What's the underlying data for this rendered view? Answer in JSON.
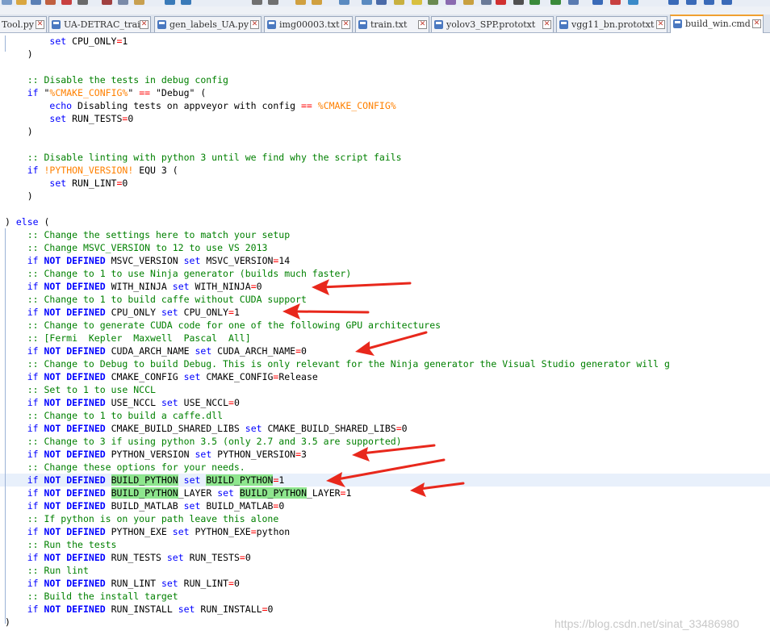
{
  "tabs": [
    {
      "label": "Tool.py"
    },
    {
      "label": "UA-DETRAC_train"
    },
    {
      "label": "gen_labels_UA.py"
    },
    {
      "label": "img00003.txt"
    },
    {
      "label": "train.txt"
    },
    {
      "label": "yolov3_SPP.prototxt"
    },
    {
      "label": "vgg11_bn.prototxt"
    },
    {
      "label": "build_win.cmd"
    }
  ],
  "active_tab_index": 7,
  "colors": {
    "keyword": "#0000ff",
    "comment": "#008000",
    "operator": "#ff0000",
    "variable": "#ff8000",
    "match_highlight": "#8ee68e",
    "arrow": "#e8281c"
  },
  "code_lines": [
    [
      {
        "t": "        "
      },
      {
        "t": "set",
        "s": "k"
      },
      {
        "t": " CPU_ONLY"
      },
      {
        "t": "=",
        "s": "o"
      },
      {
        "t": "1"
      }
    ],
    [
      {
        "t": "    )"
      }
    ],
    [
      {
        "t": ""
      }
    ],
    [
      {
        "t": "    "
      },
      {
        "t": ":: Disable the tests in debug config",
        "s": "c"
      }
    ],
    [
      {
        "t": "    "
      },
      {
        "t": "if",
        "s": "k"
      },
      {
        "t": " \""
      },
      {
        "t": "%CMAKE_CONFIG%",
        "s": "v"
      },
      {
        "t": "\" "
      },
      {
        "t": "==",
        "s": "o"
      },
      {
        "t": " \"Debug\" ("
      }
    ],
    [
      {
        "t": "        "
      },
      {
        "t": "echo",
        "s": "k"
      },
      {
        "t": " Disabling tests on appveyor with config "
      },
      {
        "t": "==",
        "s": "o"
      },
      {
        "t": " "
      },
      {
        "t": "%CMAKE_CONFIG%",
        "s": "v"
      }
    ],
    [
      {
        "t": "        "
      },
      {
        "t": "set",
        "s": "k"
      },
      {
        "t": " RUN_TESTS"
      },
      {
        "t": "=",
        "s": "o"
      },
      {
        "t": "0"
      }
    ],
    [
      {
        "t": "    )"
      }
    ],
    [
      {
        "t": ""
      }
    ],
    [
      {
        "t": "    "
      },
      {
        "t": ":: Disable linting with python 3 until we find why the script fails",
        "s": "c"
      }
    ],
    [
      {
        "t": "    "
      },
      {
        "t": "if",
        "s": "k"
      },
      {
        "t": " "
      },
      {
        "t": "!PYTHON_VERSION!",
        "s": "v"
      },
      {
        "t": " EQU 3 ("
      }
    ],
    [
      {
        "t": "        "
      },
      {
        "t": "set",
        "s": "k"
      },
      {
        "t": " RUN_LINT"
      },
      {
        "t": "=",
        "s": "o"
      },
      {
        "t": "0"
      }
    ],
    [
      {
        "t": "    )"
      }
    ],
    [
      {
        "t": ""
      }
    ],
    [
      {
        "t": ") "
      },
      {
        "t": "else",
        "s": "k"
      },
      {
        "t": " ("
      }
    ],
    [
      {
        "t": "    "
      },
      {
        "t": ":: Change the settings here to match your setup",
        "s": "c"
      }
    ],
    [
      {
        "t": "    "
      },
      {
        "t": ":: Change MSVC_VERSION to 12 to use VS 2013",
        "s": "c"
      }
    ],
    [
      {
        "t": "    "
      },
      {
        "t": "if",
        "s": "k"
      },
      {
        "t": " "
      },
      {
        "t": "NOT",
        "s": "kb"
      },
      {
        "t": " "
      },
      {
        "t": "DEFINED",
        "s": "kb"
      },
      {
        "t": " MSVC_VERSION "
      },
      {
        "t": "set",
        "s": "k"
      },
      {
        "t": " MSVC_VERSION"
      },
      {
        "t": "=",
        "s": "o"
      },
      {
        "t": "14"
      }
    ],
    [
      {
        "t": "    "
      },
      {
        "t": ":: Change to 1 to use Ninja generator (builds much faster)",
        "s": "c"
      }
    ],
    [
      {
        "t": "    "
      },
      {
        "t": "if",
        "s": "k"
      },
      {
        "t": " "
      },
      {
        "t": "NOT",
        "s": "kb"
      },
      {
        "t": " "
      },
      {
        "t": "DEFINED",
        "s": "kb"
      },
      {
        "t": " WITH_NINJA "
      },
      {
        "t": "set",
        "s": "k"
      },
      {
        "t": " WITH_NINJA"
      },
      {
        "t": "=",
        "s": "o"
      },
      {
        "t": "0"
      }
    ],
    [
      {
        "t": "    "
      },
      {
        "t": ":: Change to 1 to build caffe without CUDA support",
        "s": "c"
      }
    ],
    [
      {
        "t": "    "
      },
      {
        "t": "if",
        "s": "k"
      },
      {
        "t": " "
      },
      {
        "t": "NOT",
        "s": "kb"
      },
      {
        "t": " "
      },
      {
        "t": "DEFINED",
        "s": "kb"
      },
      {
        "t": " CPU_ONLY "
      },
      {
        "t": "set",
        "s": "k"
      },
      {
        "t": " CPU_ONLY"
      },
      {
        "t": "=",
        "s": "o"
      },
      {
        "t": "1"
      }
    ],
    [
      {
        "t": "    "
      },
      {
        "t": ":: Change to generate CUDA code for one of the following GPU architectures",
        "s": "c"
      }
    ],
    [
      {
        "t": "    "
      },
      {
        "t": ":: [Fermi  Kepler  Maxwell  Pascal  All]",
        "s": "c"
      }
    ],
    [
      {
        "t": "    "
      },
      {
        "t": "if",
        "s": "k"
      },
      {
        "t": " "
      },
      {
        "t": "NOT",
        "s": "kb"
      },
      {
        "t": " "
      },
      {
        "t": "DEFINED",
        "s": "kb"
      },
      {
        "t": " CUDA_ARCH_NAME "
      },
      {
        "t": "set",
        "s": "k"
      },
      {
        "t": " CUDA_ARCH_NAME"
      },
      {
        "t": "=",
        "s": "o"
      },
      {
        "t": "0"
      }
    ],
    [
      {
        "t": "    "
      },
      {
        "t": ":: Change to Debug to build Debug. This is only relevant for the Ninja generator the Visual Studio generator will g",
        "s": "c"
      }
    ],
    [
      {
        "t": "    "
      },
      {
        "t": "if",
        "s": "k"
      },
      {
        "t": " "
      },
      {
        "t": "NOT",
        "s": "kb"
      },
      {
        "t": " "
      },
      {
        "t": "DEFINED",
        "s": "kb"
      },
      {
        "t": " CMAKE_CONFIG "
      },
      {
        "t": "set",
        "s": "k"
      },
      {
        "t": " CMAKE_CONFIG"
      },
      {
        "t": "=",
        "s": "o"
      },
      {
        "t": "Release"
      }
    ],
    [
      {
        "t": "    "
      },
      {
        "t": ":: Set to 1 to use NCCL",
        "s": "c"
      }
    ],
    [
      {
        "t": "    "
      },
      {
        "t": "if",
        "s": "k"
      },
      {
        "t": " "
      },
      {
        "t": "NOT",
        "s": "kb"
      },
      {
        "t": " "
      },
      {
        "t": "DEFINED",
        "s": "kb"
      },
      {
        "t": " USE_NCCL "
      },
      {
        "t": "set",
        "s": "k"
      },
      {
        "t": " USE_NCCL"
      },
      {
        "t": "=",
        "s": "o"
      },
      {
        "t": "0"
      }
    ],
    [
      {
        "t": "    "
      },
      {
        "t": ":: Change to 1 to build a caffe.dll",
        "s": "c"
      }
    ],
    [
      {
        "t": "    "
      },
      {
        "t": "if",
        "s": "k"
      },
      {
        "t": " "
      },
      {
        "t": "NOT",
        "s": "kb"
      },
      {
        "t": " "
      },
      {
        "t": "DEFINED",
        "s": "kb"
      },
      {
        "t": " CMAKE_BUILD_SHARED_LIBS "
      },
      {
        "t": "set",
        "s": "k"
      },
      {
        "t": " CMAKE_BUILD_SHARED_LIBS"
      },
      {
        "t": "=",
        "s": "o"
      },
      {
        "t": "0"
      }
    ],
    [
      {
        "t": "    "
      },
      {
        "t": ":: Change to 3 if using python 3.5 (only 2.7 and 3.5 are supported)",
        "s": "c"
      }
    ],
    [
      {
        "t": "    "
      },
      {
        "t": "if",
        "s": "k"
      },
      {
        "t": " "
      },
      {
        "t": "NOT",
        "s": "kb"
      },
      {
        "t": " "
      },
      {
        "t": "DEFINED",
        "s": "kb"
      },
      {
        "t": " PYTHON_VERSION "
      },
      {
        "t": "set",
        "s": "k"
      },
      {
        "t": " PYTHON_VERSION"
      },
      {
        "t": "=",
        "s": "o"
      },
      {
        "t": "3"
      }
    ],
    [
      {
        "t": "    "
      },
      {
        "t": ":: Change these options for your needs.",
        "s": "c"
      }
    ],
    [
      {
        "t": "    "
      },
      {
        "t": "if",
        "s": "k"
      },
      {
        "t": " "
      },
      {
        "t": "NOT",
        "s": "kb"
      },
      {
        "t": " "
      },
      {
        "t": "DEFINED",
        "s": "kb"
      },
      {
        "t": " "
      },
      {
        "t": "BUILD_PYTHON",
        "s": "hv"
      },
      {
        "t": " "
      },
      {
        "t": "set",
        "s": "k"
      },
      {
        "t": " "
      },
      {
        "t": "BUILD_PYTHON",
        "s": "hv"
      },
      {
        "t": "=",
        "s": "o"
      },
      {
        "t": "1"
      }
    ],
    [
      {
        "t": "    "
      },
      {
        "t": "if",
        "s": "k"
      },
      {
        "t": " "
      },
      {
        "t": "NOT",
        "s": "kb"
      },
      {
        "t": " "
      },
      {
        "t": "DEFINED",
        "s": "kb"
      },
      {
        "t": " "
      },
      {
        "t": "BUILD_PYTHON",
        "s": "hv"
      },
      {
        "t": "_LAYER "
      },
      {
        "t": "set",
        "s": "k"
      },
      {
        "t": " "
      },
      {
        "t": "BUILD_PYTHON",
        "s": "hv"
      },
      {
        "t": "_LAYER"
      },
      {
        "t": "=",
        "s": "o"
      },
      {
        "t": "1"
      }
    ],
    [
      {
        "t": "    "
      },
      {
        "t": "if",
        "s": "k"
      },
      {
        "t": " "
      },
      {
        "t": "NOT",
        "s": "kb"
      },
      {
        "t": " "
      },
      {
        "t": "DEFINED",
        "s": "kb"
      },
      {
        "t": " BUILD_MATLAB "
      },
      {
        "t": "set",
        "s": "k"
      },
      {
        "t": " BUILD_MATLAB"
      },
      {
        "t": "=",
        "s": "o"
      },
      {
        "t": "0"
      }
    ],
    [
      {
        "t": "    "
      },
      {
        "t": ":: If python is on your path leave this alone",
        "s": "c"
      }
    ],
    [
      {
        "t": "    "
      },
      {
        "t": "if",
        "s": "k"
      },
      {
        "t": " "
      },
      {
        "t": "NOT",
        "s": "kb"
      },
      {
        "t": " "
      },
      {
        "t": "DEFINED",
        "s": "kb"
      },
      {
        "t": " PYTHON_EXE "
      },
      {
        "t": "set",
        "s": "k"
      },
      {
        "t": " PYTHON_EXE"
      },
      {
        "t": "=",
        "s": "o"
      },
      {
        "t": "python"
      }
    ],
    [
      {
        "t": "    "
      },
      {
        "t": ":: Run the tests",
        "s": "c"
      }
    ],
    [
      {
        "t": "    "
      },
      {
        "t": "if",
        "s": "k"
      },
      {
        "t": " "
      },
      {
        "t": "NOT",
        "s": "kb"
      },
      {
        "t": " "
      },
      {
        "t": "DEFINED",
        "s": "kb"
      },
      {
        "t": " RUN_TESTS "
      },
      {
        "t": "set",
        "s": "k"
      },
      {
        "t": " RUN_TESTS"
      },
      {
        "t": "=",
        "s": "o"
      },
      {
        "t": "0"
      }
    ],
    [
      {
        "t": "    "
      },
      {
        "t": ":: Run lint",
        "s": "c"
      }
    ],
    [
      {
        "t": "    "
      },
      {
        "t": "if",
        "s": "k"
      },
      {
        "t": " "
      },
      {
        "t": "NOT",
        "s": "kb"
      },
      {
        "t": " "
      },
      {
        "t": "DEFINED",
        "s": "kb"
      },
      {
        "t": " RUN_LINT "
      },
      {
        "t": "set",
        "s": "k"
      },
      {
        "t": " RUN_LINT"
      },
      {
        "t": "=",
        "s": "o"
      },
      {
        "t": "0"
      }
    ],
    [
      {
        "t": "    "
      },
      {
        "t": ":: Build the install target",
        "s": "c"
      }
    ],
    [
      {
        "t": "    "
      },
      {
        "t": "if",
        "s": "k"
      },
      {
        "t": " "
      },
      {
        "t": "NOT",
        "s": "kb"
      },
      {
        "t": " "
      },
      {
        "t": "DEFINED",
        "s": "kb"
      },
      {
        "t": " RUN_INSTALL "
      },
      {
        "t": "set",
        "s": "k"
      },
      {
        "t": " RUN_INSTALL"
      },
      {
        "t": "=",
        "s": "o"
      },
      {
        "t": "0"
      }
    ],
    [
      {
        "t": ")"
      }
    ]
  ],
  "current_line_index": 34,
  "watermark": "https://blog.csdn.net/sinat_33486980"
}
